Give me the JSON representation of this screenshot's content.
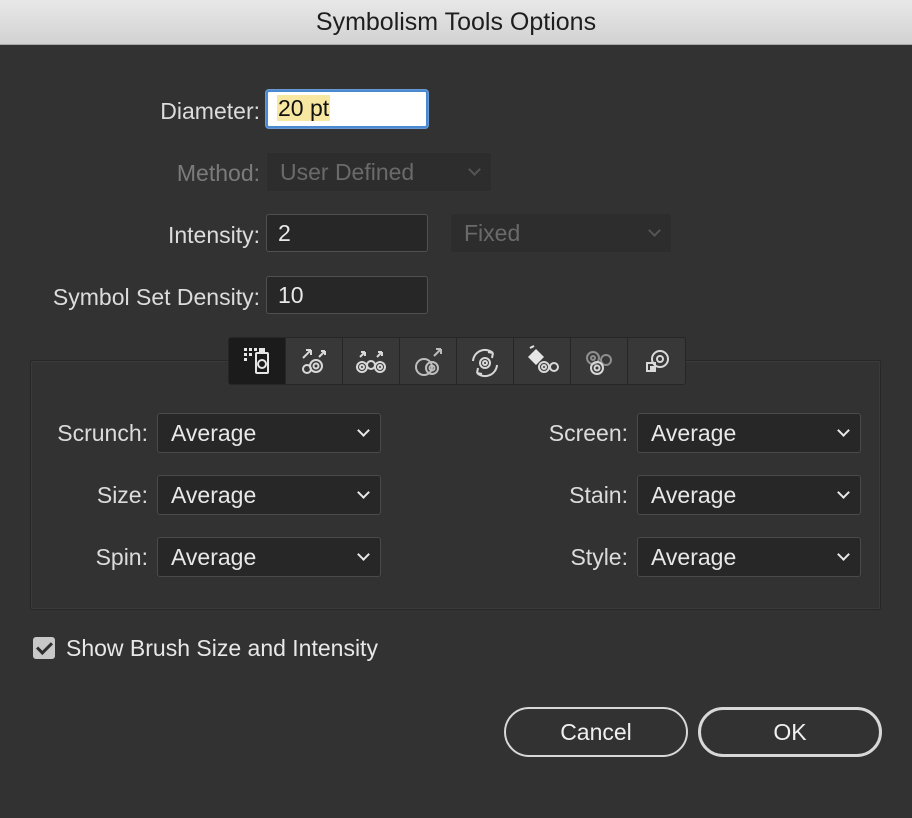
{
  "window": {
    "title": "Symbolism Tools Options"
  },
  "diameter": {
    "label": "Diameter:",
    "value": "20 pt"
  },
  "method": {
    "label": "Method:",
    "value": "User Defined"
  },
  "intensity": {
    "label": "Intensity:",
    "value": "2",
    "mode": "Fixed"
  },
  "density": {
    "label": "Symbol Set Density:",
    "value": "10"
  },
  "tools": [
    {
      "name": "sprayer-tool-icon",
      "active": true
    },
    {
      "name": "shifter-tool-icon",
      "active": false
    },
    {
      "name": "scruncher-tool-icon",
      "active": false
    },
    {
      "name": "sizer-tool-icon",
      "active": false
    },
    {
      "name": "spinner-tool-icon",
      "active": false
    },
    {
      "name": "stainer-tool-icon",
      "active": false
    },
    {
      "name": "screener-tool-icon",
      "active": false
    },
    {
      "name": "styler-tool-icon",
      "active": false
    }
  ],
  "options": {
    "scrunch": {
      "label": "Scrunch:",
      "value": "Average"
    },
    "size": {
      "label": "Size:",
      "value": "Average"
    },
    "spin": {
      "label": "Spin:",
      "value": "Average"
    },
    "screen": {
      "label": "Screen:",
      "value": "Average"
    },
    "stain": {
      "label": "Stain:",
      "value": "Average"
    },
    "style": {
      "label": "Style:",
      "value": "Average"
    }
  },
  "show_brush": {
    "label": "Show Brush Size and Intensity",
    "checked": true
  },
  "buttons": {
    "cancel": "Cancel",
    "ok": "OK"
  }
}
